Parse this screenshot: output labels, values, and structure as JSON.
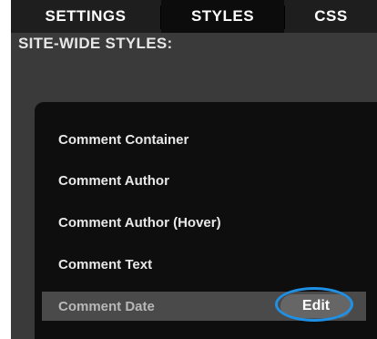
{
  "tabs": [
    {
      "label": "SETTINGS"
    },
    {
      "label": "STYLES",
      "active": true
    },
    {
      "label": "CSS"
    }
  ],
  "section": {
    "title": "SITE-WIDE STYLES:"
  },
  "style_items": [
    {
      "label": "Comment Container"
    },
    {
      "label": "Comment Author"
    },
    {
      "label": "Comment Author (Hover)"
    },
    {
      "label": "Comment Text"
    },
    {
      "label": "Comment Date",
      "selected": true
    }
  ],
  "edit_button": {
    "label": "Edit"
  },
  "colors": {
    "panel_bg": "#3a3a3a",
    "tabbar_bg": "#1e1e1e",
    "active_tab_bg": "#0c0c0c",
    "list_bg": "#0e0e0e",
    "selected_row_bg": "#4a4a4a",
    "highlight": "#1e90e6"
  }
}
